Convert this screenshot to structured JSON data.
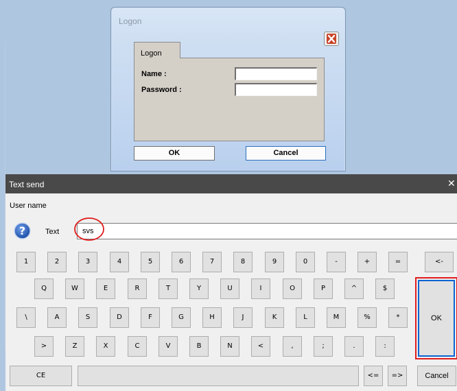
{
  "logon": {
    "title": "Logon",
    "tab_label": "Logon",
    "name_label": "Name :",
    "password_label": "Password :",
    "ok_label": "OK",
    "cancel_label": "Cancel"
  },
  "text_send": {
    "title": "Text send",
    "close_glyph": "✕",
    "user_name_label": "User name",
    "text_label": "Text",
    "text_value": "svs",
    "keys_row1": [
      "1",
      "2",
      "3",
      "4",
      "5",
      "6",
      "7",
      "8",
      "9",
      "0",
      "-",
      "+",
      "=",
      "<-"
    ],
    "keys_row2": [
      "Q",
      "W",
      "E",
      "R",
      "T",
      "Y",
      "U",
      "I",
      "O",
      "P",
      "^",
      "$"
    ],
    "keys_row3": [
      "\\",
      "A",
      "S",
      "D",
      "F",
      "G",
      "H",
      "J",
      "K",
      "L",
      "M",
      "%",
      "*"
    ],
    "keys_row4": [
      ">",
      "Z",
      "X",
      "C",
      "V",
      "B",
      "N",
      "<",
      ",",
      ";",
      ".",
      ":"
    ],
    "ce_label": "CE",
    "left_arrow_label": "<=",
    "right_arrow_label": "=>",
    "ok_label": "OK",
    "cancel_label": "Cancel"
  },
  "colors": {
    "highlight_red": "#e01b1b",
    "focus_blue": "#0a64d2",
    "titlebar": "#494949"
  }
}
